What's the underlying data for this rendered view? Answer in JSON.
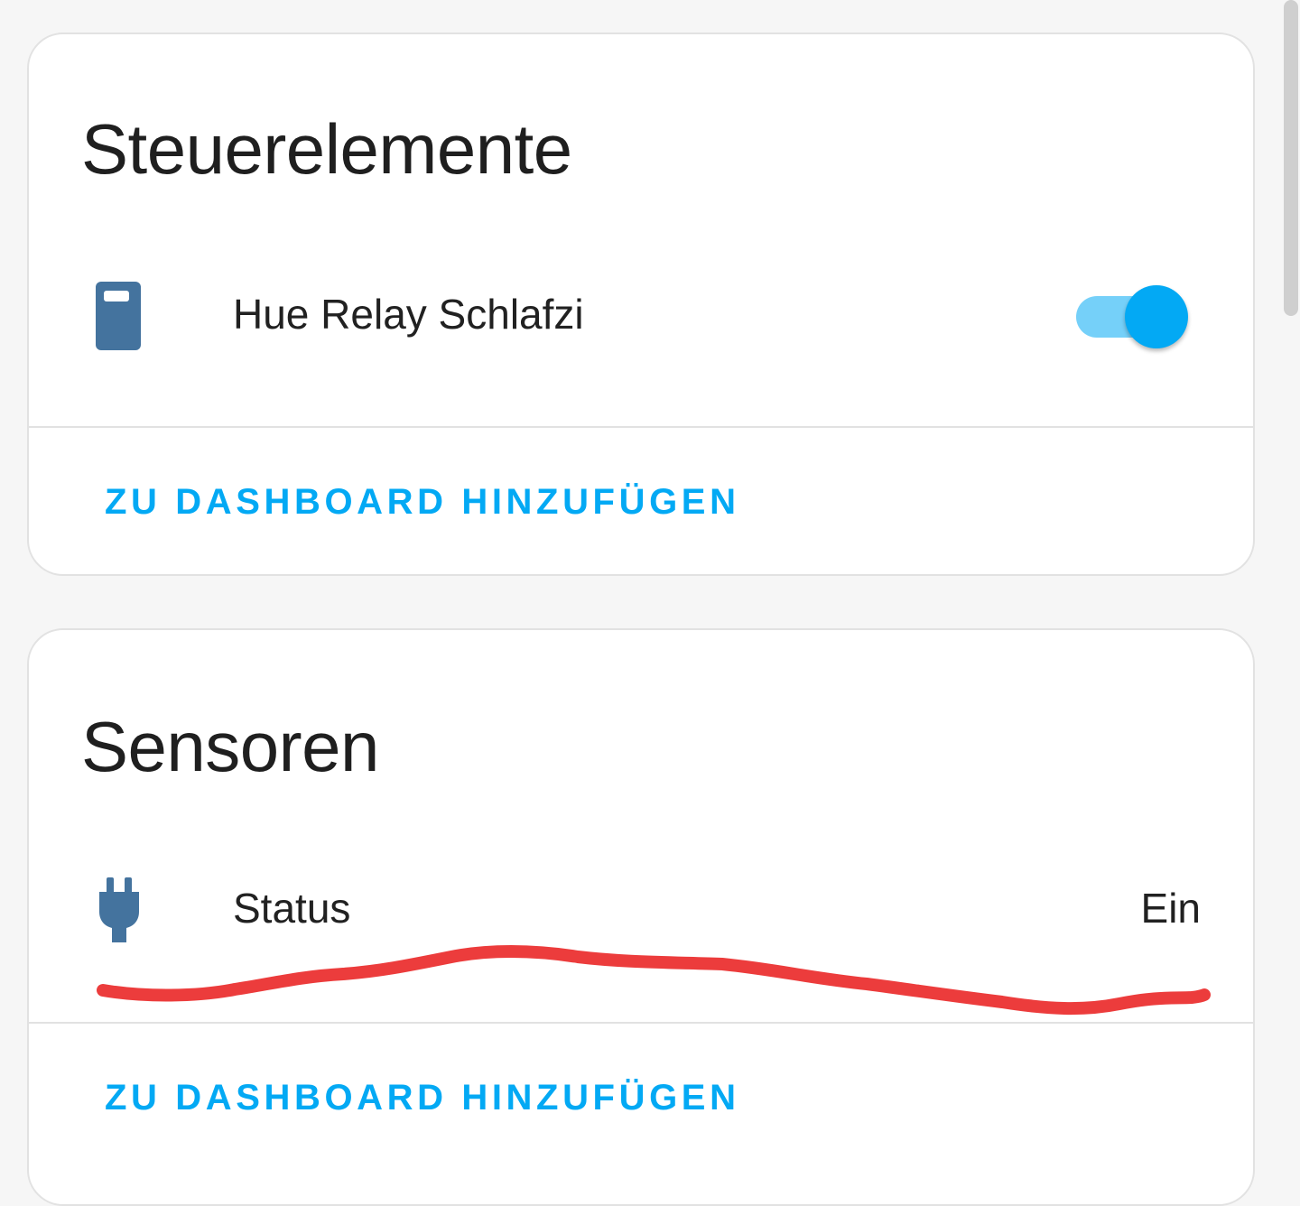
{
  "colors": {
    "accent": "#03a9f4",
    "icon": "#44739e",
    "toggle_track": "#03a9f4",
    "toggle_knob": "#03a9f4",
    "annotation_stroke": "#ec3c3c"
  },
  "controls_card": {
    "title": "Steuerelemente",
    "entity": {
      "icon": "remote-icon",
      "name": "Hue Relay Schlafzi",
      "toggle_state": "on"
    },
    "action_label": "ZU DASHBOARD HINZUFÜGEN"
  },
  "sensors_card": {
    "title": "Sensoren",
    "entity": {
      "icon": "power-plug-icon",
      "name": "Status",
      "state": "Ein"
    },
    "action_label": "ZU DASHBOARD HINZUFÜGEN"
  }
}
